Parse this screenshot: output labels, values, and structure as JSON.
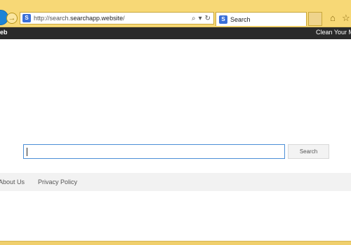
{
  "browser": {
    "url_prefix": "http://search.",
    "url_domain": "searchapp.website",
    "url_suffix": "/",
    "tab_title": "Search"
  },
  "site_toolbar": {
    "left_label": "eb",
    "right_label": "Clean Your M"
  },
  "search": {
    "value": "",
    "button_label": "Search"
  },
  "footer": {
    "links": [
      "About Us",
      "Privacy Policy"
    ]
  },
  "colors": {
    "chrome": "#f7d876",
    "site_toolbar": "#2a2a2a",
    "input_focus_border": "#4c8fd6"
  },
  "icons": [
    "back-icon",
    "forward-icon",
    "site-icon",
    "search-icon",
    "dropdown-icon",
    "refresh-icon",
    "home-icon",
    "favorites-icon"
  ]
}
